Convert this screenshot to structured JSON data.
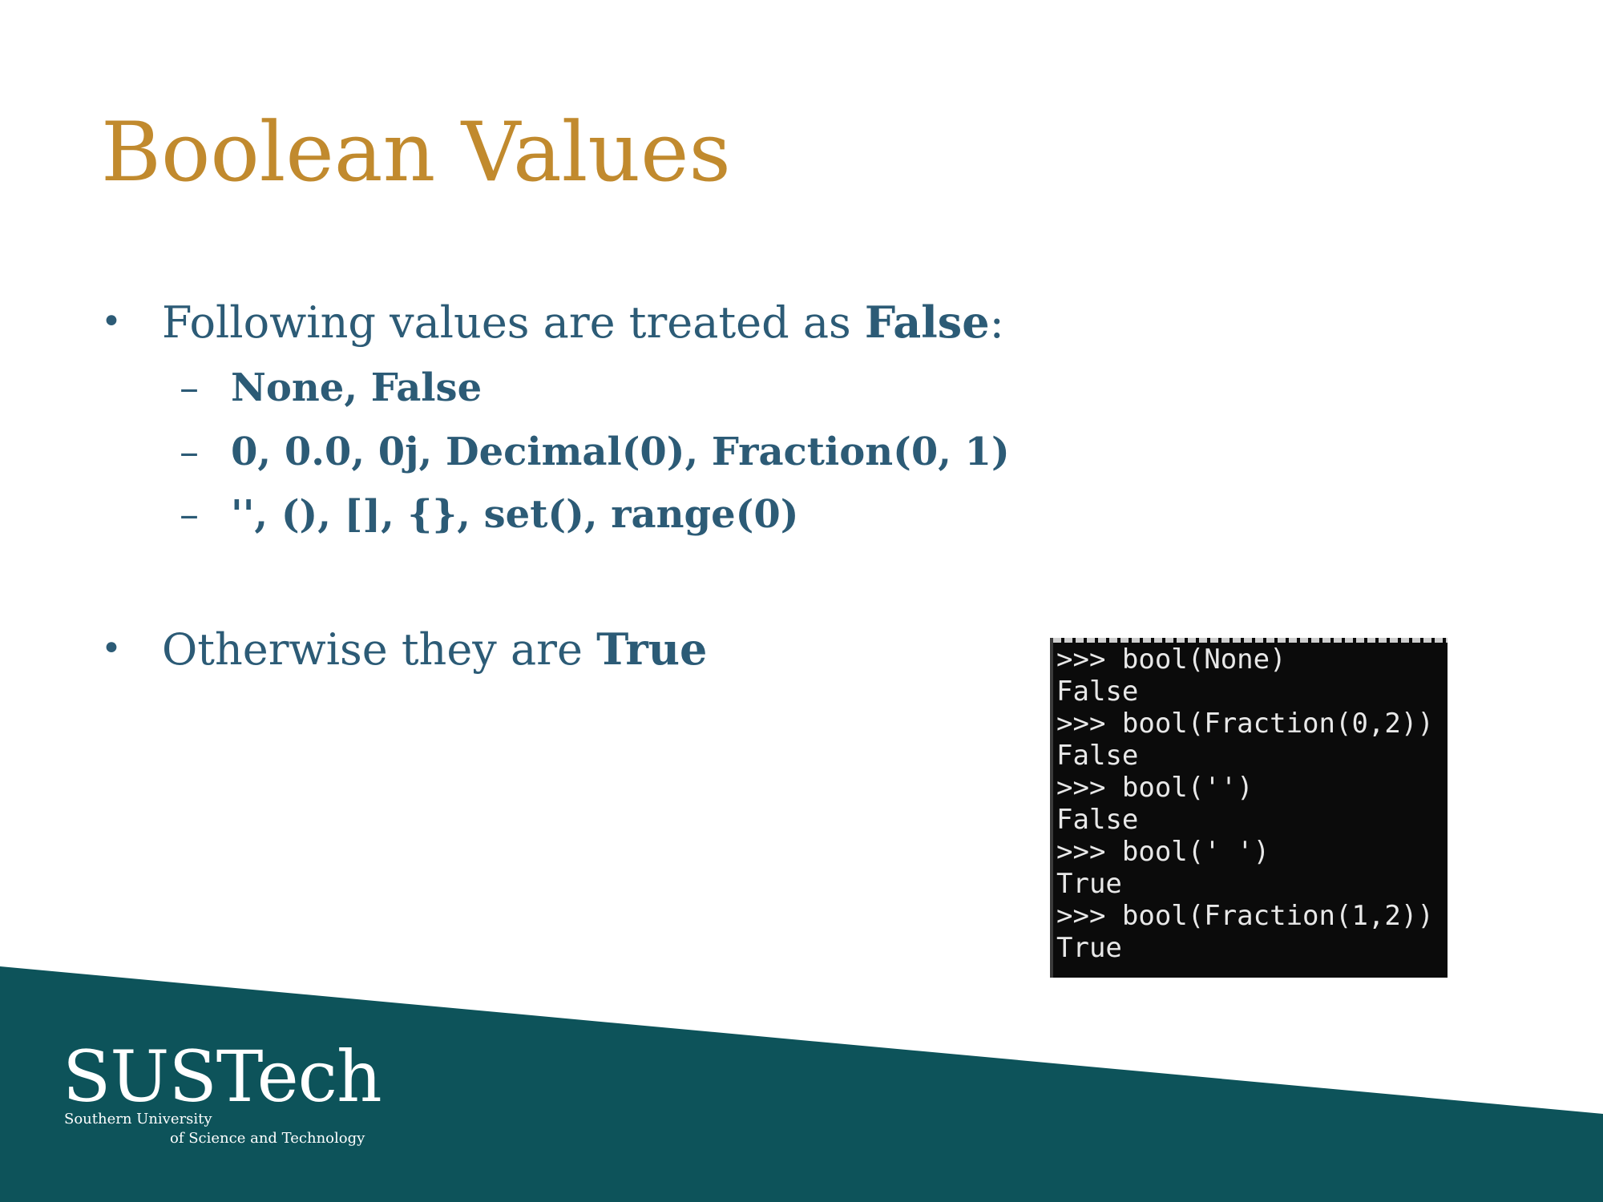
{
  "slide": {
    "title": "Boolean Values",
    "bullets": [
      {
        "marker": "•",
        "prefix": "Following values are treated as ",
        "emph": "False",
        "suffix": ":"
      },
      {
        "marker": "•",
        "prefix": "Otherwise they are ",
        "emph": "True",
        "suffix": ""
      }
    ],
    "sub_bullets": [
      {
        "marker": "–",
        "text": "None, False"
      },
      {
        "marker": "–",
        "text": "0, 0.0, 0j, Decimal(0), Fraction(0, 1)"
      },
      {
        "marker": "–",
        "text": "'', (), [], {}, set(), range(0)"
      }
    ]
  },
  "console": {
    "lines": [
      ">>> bool(None)",
      "False",
      ">>> bool(Fraction(0,2))",
      "False",
      ">>> bool('')",
      "False",
      ">>> bool(' ')",
      "True",
      ">>> bool(Fraction(1,2))",
      "True"
    ]
  },
  "logo": {
    "name": "SUSTech",
    "line1": "Southern University",
    "line2": "of Science and Technology"
  },
  "colors": {
    "title": "#c18a2e",
    "body_text": "#2c5b76",
    "band": "#0d535a",
    "console_bg": "#0b0b0b"
  }
}
